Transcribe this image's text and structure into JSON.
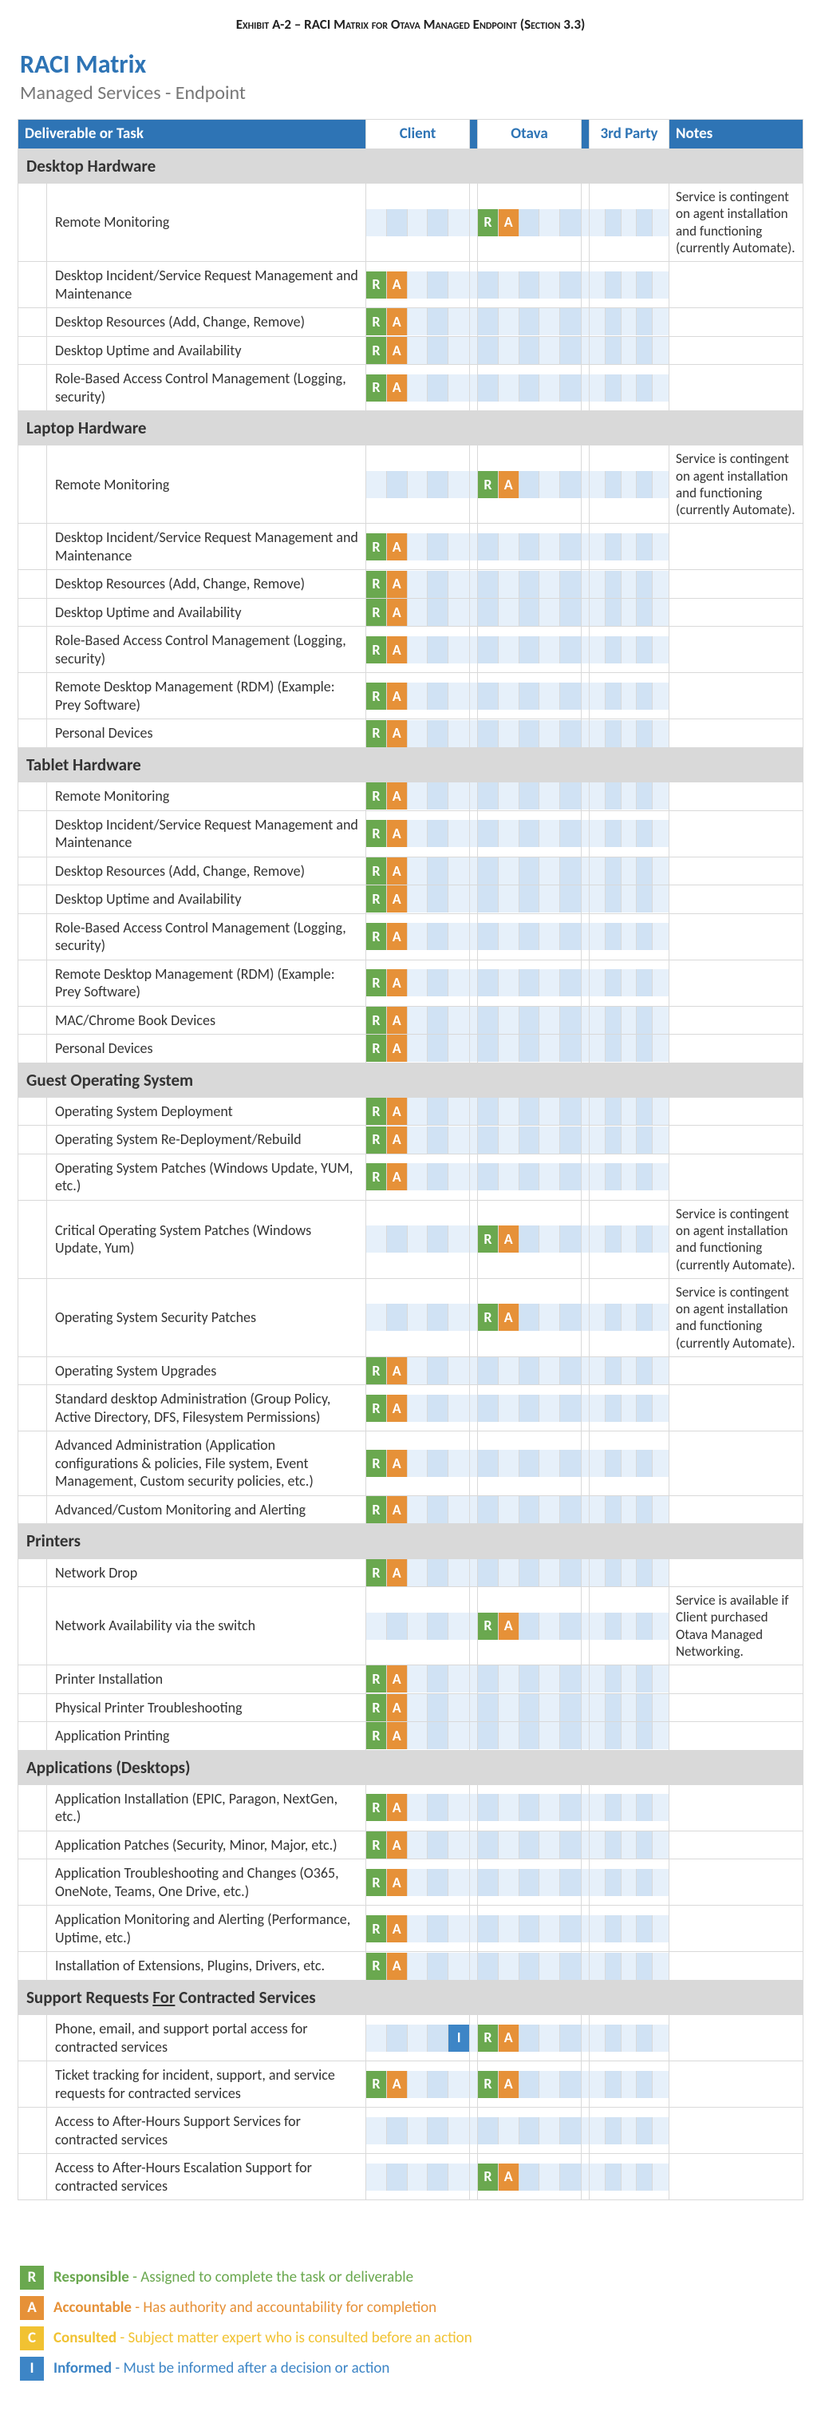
{
  "exhibit": "Exhibit A-2 – RACI Matrix for Otava Managed Endpoint (Section 3.3)",
  "title": "RACI Matrix",
  "subtitle": "Managed Services - Endpoint",
  "headers": {
    "task": "Deliverable or Task",
    "p1": "Client",
    "p2": "Otava",
    "p3": "3rd Party",
    "notes": "Notes"
  },
  "notes": {
    "agent": "Service is contingent on agent installation and functioning (currently Automate).",
    "net": "Service is available if Client purchased Otava Managed Networking."
  },
  "sections": [
    {
      "name": "Desktop Hardware",
      "rows": [
        {
          "task": "Remote Monitoring",
          "otava": [
            "R",
            "A"
          ],
          "note": "agent"
        },
        {
          "task": "Desktop Incident/Service Request Management and Maintenance",
          "client": [
            "R",
            "A"
          ]
        },
        {
          "task": "Desktop Resources (Add, Change, Remove)",
          "client": [
            "R",
            "A"
          ]
        },
        {
          "task": "Desktop Uptime and Availability",
          "client": [
            "R",
            "A"
          ]
        },
        {
          "task": "Role-Based Access Control Management (Logging, security)",
          "client": [
            "R",
            "A"
          ]
        }
      ]
    },
    {
      "name": "Laptop Hardware",
      "rows": [
        {
          "task": "Remote Monitoring",
          "otava": [
            "R",
            "A"
          ],
          "note": "agent"
        },
        {
          "task": "Desktop Incident/Service Request Management and Maintenance",
          "client": [
            "R",
            "A"
          ]
        },
        {
          "task": "Desktop Resources (Add, Change, Remove)",
          "client": [
            "R",
            "A"
          ]
        },
        {
          "task": "Desktop Uptime and Availability",
          "client": [
            "R",
            "A"
          ]
        },
        {
          "task": "Role-Based Access Control Management (Logging, security)",
          "client": [
            "R",
            "A"
          ]
        },
        {
          "task": "Remote Desktop Management (RDM) (Example: Prey Software)",
          "client": [
            "R",
            "A"
          ]
        },
        {
          "task": "Personal Devices",
          "client": [
            "R",
            "A"
          ]
        }
      ]
    },
    {
      "name": "Tablet Hardware",
      "rows": [
        {
          "task": "Remote Monitoring",
          "client": [
            "R",
            "A"
          ]
        },
        {
          "task": "Desktop Incident/Service Request Management and Maintenance",
          "client": [
            "R",
            "A"
          ]
        },
        {
          "task": "Desktop Resources (Add, Change, Remove)",
          "client": [
            "R",
            "A"
          ]
        },
        {
          "task": "Desktop Uptime and Availability",
          "client": [
            "R",
            "A"
          ]
        },
        {
          "task": "Role-Based Access Control Management (Logging, security)",
          "client": [
            "R",
            "A"
          ]
        },
        {
          "task": "Remote Desktop Management (RDM) (Example: Prey Software)",
          "client": [
            "R",
            "A"
          ]
        },
        {
          "task": "MAC/Chrome Book Devices",
          "client": [
            "R",
            "A"
          ]
        },
        {
          "task": "Personal Devices",
          "client": [
            "R",
            "A"
          ]
        }
      ]
    },
    {
      "name": "Guest Operating System",
      "rows": [
        {
          "task": "Operating System Deployment",
          "client": [
            "R",
            "A"
          ]
        },
        {
          "task": "Operating System Re-Deployment/Rebuild",
          "client": [
            "R",
            "A"
          ]
        },
        {
          "task": "Operating System Patches (Windows Update, YUM, etc.)",
          "client": [
            "R",
            "A"
          ]
        },
        {
          "task": "Critical Operating System Patches (Windows Update, Yum)",
          "otava": [
            "R",
            "A"
          ],
          "note": "agent"
        },
        {
          "task": "Operating System Security Patches",
          "otava": [
            "R",
            "A"
          ],
          "note": "agent"
        },
        {
          "task": "Operating System Upgrades",
          "client": [
            "R",
            "A"
          ]
        },
        {
          "task": "Standard desktop Administration (Group Policy, Active Directory, DFS, Filesystem Permissions)",
          "client": [
            "R",
            "A"
          ]
        },
        {
          "task": "Advanced Administration (Application configurations & policies, File system, Event Management, Custom security policies, etc.)",
          "client": [
            "R",
            "A"
          ]
        },
        {
          "task": "Advanced/Custom Monitoring and Alerting",
          "client": [
            "R",
            "A"
          ]
        }
      ]
    },
    {
      "name": "Printers",
      "rows": [
        {
          "task": "Network Drop",
          "client": [
            "R",
            "A"
          ]
        },
        {
          "task": "Network Availability via the switch",
          "otava": [
            "R",
            "A"
          ],
          "note": "net"
        },
        {
          "task": "Printer Installation",
          "client": [
            "R",
            "A"
          ]
        },
        {
          "task": "Physical Printer Troubleshooting",
          "client": [
            "R",
            "A"
          ]
        },
        {
          "task": "Application Printing",
          "client": [
            "R",
            "A"
          ]
        }
      ]
    },
    {
      "name": "Applications (Desktops)",
      "rows": [
        {
          "task": "Application Installation (EPIC, Paragon, NextGen, etc.)",
          "client": [
            "R",
            "A"
          ]
        },
        {
          "task": "Application Patches (Security, Minor, Major, etc.)",
          "client": [
            "R",
            "A"
          ]
        },
        {
          "task": "Application Troubleshooting and Changes (O365, OneNote, Teams, One Drive, etc.)",
          "client": [
            "R",
            "A"
          ]
        },
        {
          "task": "Application Monitoring and Alerting (Performance, Uptime, etc.)",
          "client": [
            "R",
            "A"
          ]
        },
        {
          "task": "Installation of Extensions, Plugins, Drivers, etc.",
          "client": [
            "R",
            "A"
          ]
        }
      ]
    },
    {
      "name": "Support Requests For Contracted Services",
      "underlineWord": "For",
      "rows": [
        {
          "task": "Phone, email, and support portal access for contracted services",
          "client": [
            "",
            "",
            "",
            "",
            "I"
          ],
          "otava": [
            "R",
            "A"
          ]
        },
        {
          "task": "Ticket tracking for incident, support, and service requests for contracted services",
          "client": [
            "R",
            "A"
          ],
          "otava": [
            "R",
            "A"
          ]
        },
        {
          "task": "Access to After-Hours Support Services for contracted services"
        },
        {
          "task": "Access to After-Hours Escalation Support for contracted services",
          "otava": [
            "R",
            "A"
          ]
        }
      ]
    }
  ],
  "legend": [
    {
      "code": "R",
      "label": "Responsible",
      "desc": "Assigned to complete the task or deliverable",
      "cls": "leg-R"
    },
    {
      "code": "A",
      "label": "Accountable",
      "desc": "Has authority and accountability for completion",
      "cls": "leg-A"
    },
    {
      "code": "C",
      "label": "Consulted",
      "desc": "Subject matter expert who is consulted before an action",
      "cls": "leg-C"
    },
    {
      "code": "I",
      "label": "Informed",
      "desc": "Must be informed after a decision or action",
      "cls": "leg-I"
    }
  ]
}
